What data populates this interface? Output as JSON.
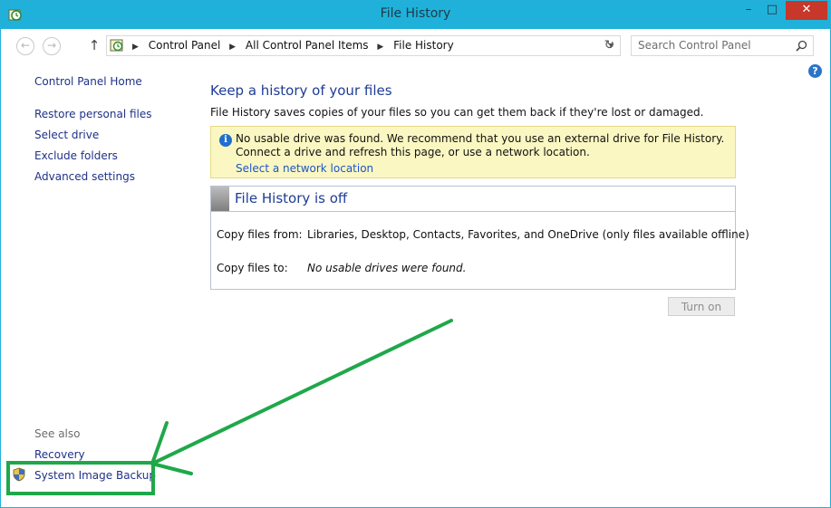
{
  "window": {
    "title": "File History"
  },
  "titlebar": {
    "minimize": "–",
    "maximize": "□",
    "close": "✕"
  },
  "address": {
    "crumbs": [
      "Control Panel",
      "All Control Panel Items",
      "File History"
    ],
    "separator": "▶"
  },
  "search": {
    "placeholder": "Search Control Panel"
  },
  "help": {
    "glyph": "?"
  },
  "sidebar": {
    "home": "Control Panel Home",
    "links": [
      "Restore personal files",
      "Select drive",
      "Exclude folders",
      "Advanced settings"
    ],
    "see_also": "See also",
    "see_also_links": [
      "Recovery",
      "System Image Backup"
    ]
  },
  "main": {
    "heading": "Keep a history of your files",
    "intro": "File History saves copies of your files so you can get them back if they're lost or damaged.",
    "warning": {
      "icon": "i",
      "message": "No usable drive was found. We recommend that you use an external drive for File History. Connect a drive and refresh this page, or use a network location.",
      "link": "Select a network location"
    },
    "status": {
      "title": "File History is off",
      "copy_from_label": "Copy files from:",
      "copy_from_value": "Libraries, Desktop, Contacts, Favorites, and OneDrive (only files available offline)",
      "copy_to_label": "Copy files to:",
      "copy_to_value": "No usable drives were found."
    },
    "turn_on": "Turn on"
  },
  "colors": {
    "titlebar": "#1fb1d9",
    "link": "#1e3287",
    "heading": "#1e3c96",
    "warning_bg": "#fbf7c2",
    "annotation": "#1fa84a"
  }
}
